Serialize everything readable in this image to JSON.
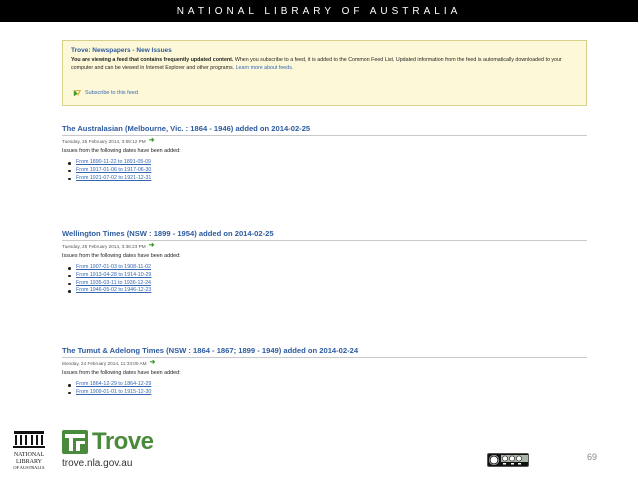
{
  "header": {
    "title": "NATIONAL LIBRARY OF AUSTRALIA"
  },
  "notice": {
    "title": "Trove: Newspapers - New Issues",
    "bold_text": "You are viewing a feed that contains frequently updated content.",
    "body_text": " When you subscribe to a feed, it is added to the Common Feed List. Updated information from the feed is automatically downloaded to your computer and can be viewed in Internet Explorer and other programs.",
    "learn_more": "Learn more about feeds.",
    "subscribe": "Subscribe to this feed"
  },
  "feeds": [
    {
      "title": "The Australasian (Melbourne, Vic. : 1864 - 1946) added on 2014-02-25",
      "timestamp": "Tuesday, 25 February 2014, 3:59:12 PM",
      "intro": "Issues from the following dates have been added:",
      "issues": [
        "From 1890-11-22 to 1891-05-09",
        "From 1917-01-06 to 1917-06-30",
        "From 1921-07-02 to 1921-12-31"
      ]
    },
    {
      "title": "Wellington Times (NSW : 1899 - 1954) added on 2014-02-25",
      "timestamp": "Tuesday, 25 February 2014, 3:36:23 PM",
      "intro": "Issues from the following dates have been added:",
      "issues": [
        "From 1907-01-03 to 1908-11-02",
        "From 1913-04-28 to 1914-10-29",
        "From 1935-03-11 to 1936-12-24",
        "From 1946-05-02 to 1946-12-23"
      ]
    },
    {
      "title": "The Tumut & Adelong Times (NSW : 1864 - 1867; 1899 - 1949) added on 2014-02-24",
      "timestamp": "Monday, 24 February 2014, 11:33:00 AM",
      "intro": "Issues from the following dates have been added:",
      "issues": [
        "From 1864-12-29 to 1864-12-29",
        "From 1909-01-01 to 1915-12-30"
      ]
    }
  ],
  "footer": {
    "nla_logo_text": [
      "NATIONAL",
      "LIBRARY",
      "OF AUSTRALIA"
    ],
    "trove_name": "Trove",
    "trove_url": "trove.nla.gov.au",
    "page_number": "69"
  },
  "colors": {
    "accent_blue": "#2c5aa0",
    "trove_green": "#4a8a3c",
    "notice_bg": "#fdf9d8"
  },
  "icons": [
    "rss-icon",
    "green-arrow-icon",
    "nla-logo",
    "trove-logo",
    "creative-commons-icon"
  ]
}
